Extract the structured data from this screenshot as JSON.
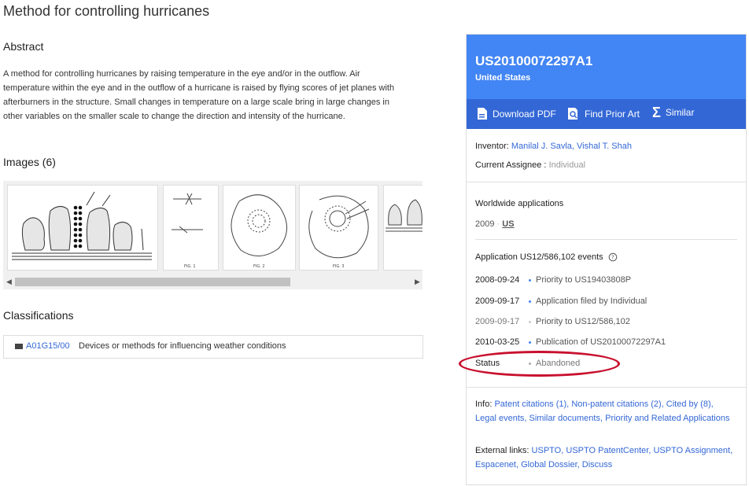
{
  "page": {
    "title": "Method for controlling hurricanes"
  },
  "abstract": {
    "heading": "Abstract",
    "text": "A method for controlling hurricanes by raising temperature in the eye and/or in the outflow. Air temperature within the eye and in the outflow of a hurricane is raised by flying scores of jet planes with afterburners in the structure. Small changes in temperature on a large scale bring in large changes in other variables on the smaller scale to change the direction and intensity of the hurricane."
  },
  "images": {
    "heading": "Images (6)",
    "thumbnails": [
      "FIG. 1",
      "FIG. 2",
      "FIG. 3"
    ]
  },
  "classifications": {
    "heading": "Classifications",
    "items": [
      {
        "code": "A01G15/00",
        "description": "Devices or methods for influencing weather conditions"
      }
    ]
  },
  "panel": {
    "publication_number": "US20100072297A1",
    "country": "United States",
    "actions": {
      "download_pdf": "Download PDF",
      "find_prior_art": "Find Prior Art",
      "similar": "Similar"
    },
    "inventor_label": "Inventor:",
    "inventors": [
      "Manilal J. Savla",
      "Vishal T. Shah"
    ],
    "assignee_label": "Current Assignee :",
    "assignee": "Individual",
    "worldwide_heading": "Worldwide applications",
    "worldwide_year": "2009",
    "worldwide_country": "US",
    "events_heading": "Application US12/586,102 events",
    "events": [
      {
        "date": "2008-09-24",
        "text": "Priority to US19403808P",
        "muted": false
      },
      {
        "date": "2009-09-17",
        "text": "Application filed by Individual",
        "muted": false
      },
      {
        "date": "2009-09-17",
        "text": "Priority to US12/586,102",
        "muted": true
      },
      {
        "date": "2010-03-25",
        "text": "Publication of US20100072297A1",
        "muted": false
      }
    ],
    "status_label": "Status",
    "status_value": "Abandoned",
    "info_label": "Info:",
    "info_links": {
      "patent_citations": "Patent citations (1),",
      "non_patent_citations": "Non-patent citations (2),",
      "cited_by": "Cited by (8),",
      "legal_events": "Legal events,",
      "similar_documents": "Similar documents,",
      "priority": "Priority and Related Applications"
    },
    "external_label": "External links:",
    "external_links": {
      "uspto": "USPTO,",
      "patentcenter": "USPTO PatentCenter,",
      "assignment": "USPTO Assignment,",
      "espacenet": "Espacenet,",
      "global_dossier": "Global Dossier,",
      "discuss": "Discuss"
    }
  }
}
